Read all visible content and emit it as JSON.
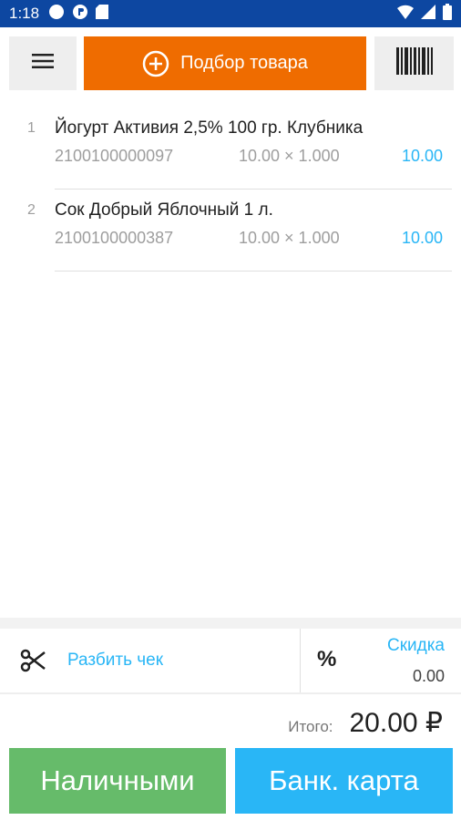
{
  "statusbar": {
    "time": "1:18"
  },
  "toolbar": {
    "pick_label": "Подбор товара"
  },
  "items": [
    {
      "num": "1",
      "name": "Йогурт Активия 2,5% 100 гр. Клубника",
      "code": "2100100000097",
      "qty": "10.00 × 1.000",
      "sum": "10.00"
    },
    {
      "num": "2",
      "name": "Сок Добрый Яблочный 1 л.",
      "code": "2100100000387",
      "qty": "10.00 × 1.000",
      "sum": "10.00"
    }
  ],
  "actions": {
    "split_label": "Разбить чек",
    "discount_symbol": "%",
    "discount_label": "Скидка",
    "discount_value": "0.00"
  },
  "total": {
    "label": "Итого:",
    "value": "20.00 ₽"
  },
  "payment": {
    "cash_label": "Наличными",
    "card_label": "Банк. карта"
  },
  "colors": {
    "primary": "#0d47a1",
    "accent": "#ef6c00",
    "cash": "#66bb6a",
    "card": "#29b6f6"
  }
}
